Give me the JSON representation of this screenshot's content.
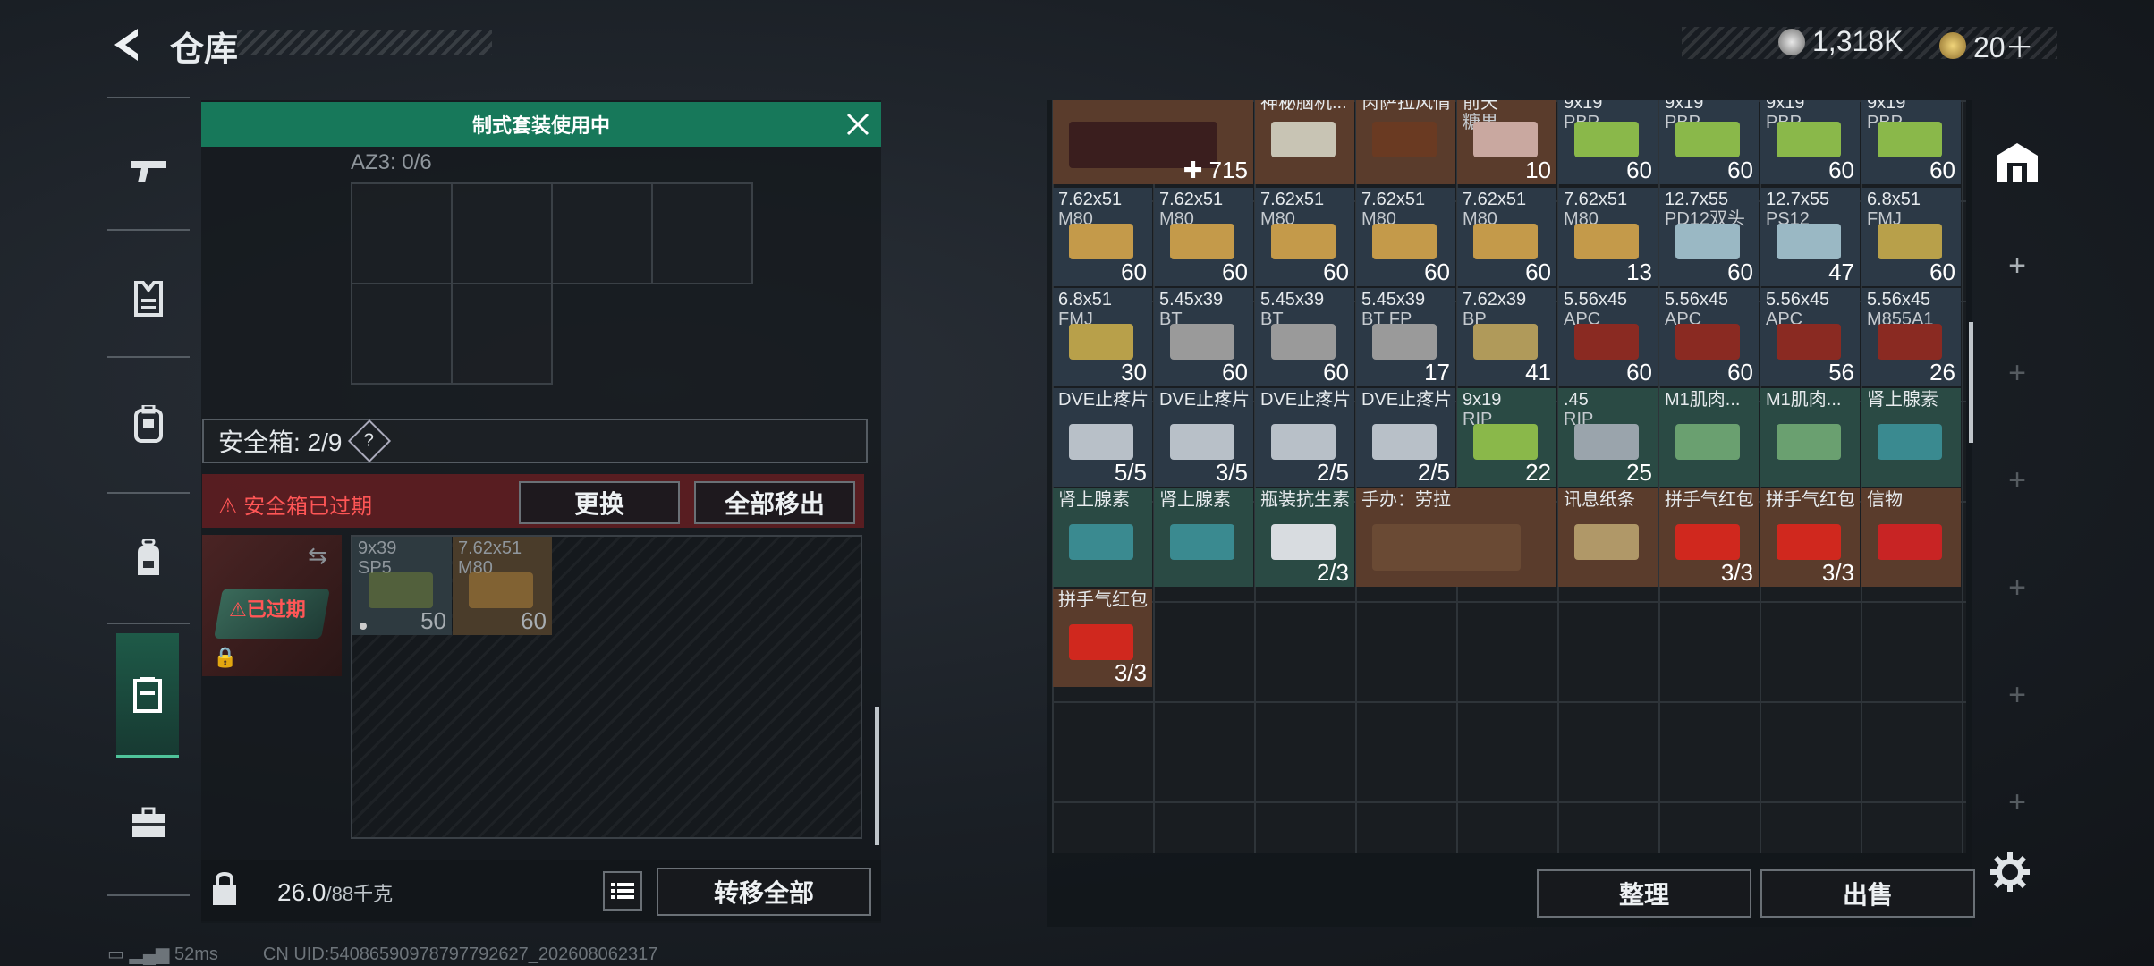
{
  "header": {
    "title": "仓库",
    "currency": [
      {
        "icon": "silver-coin-icon",
        "value": "1,318K"
      },
      {
        "icon": "gold-coin-icon",
        "value": "20＋"
      }
    ]
  },
  "left": {
    "kit_banner": "制式套装使用中",
    "az3_label": "AZ3: 0/6",
    "safe_box_label": "安全箱: 2/9",
    "safe_box_help": "?",
    "expired_warning": "安全箱已过期",
    "replace_label": "更换",
    "move_all_out_label": "全部移出",
    "thumb_expired": "已过期",
    "safe_items": [
      {
        "name": "9x39",
        "name2": "SP5",
        "count": "50",
        "color": "#7a8a3a"
      },
      {
        "name": "7.62x51",
        "name2": "M80",
        "count": "60",
        "color": "#a67c3a"
      }
    ],
    "weight_value": "26.0",
    "weight_max": "/88千克",
    "transfer_all_label": "转移全部"
  },
  "inventory": {
    "rows": [
      [
        {
          "name": "",
          "count": "715",
          "count_prefix": "✚",
          "color": "#3a1e1e",
          "span": 2,
          "bg": "#5a3c2c"
        },
        {
          "name": "神秘脑机...",
          "count": "",
          "color": "#c8c4b4",
          "bg": "#5a3c2c"
        },
        {
          "name": "芮萨拉风情",
          "count": "",
          "color": "#6a3a22",
          "bg": "#5a3c2c"
        },
        {
          "name": "前天",
          "name2": "糖果",
          "count": "10",
          "color": "#c9a8a0",
          "bg": "#5a3c2c"
        },
        {
          "name": "9x19",
          "name2": "PBP",
          "count": "60",
          "color": "#8ab84a",
          "bg": "#2c3946"
        },
        {
          "name": "9x19",
          "name2": "PBP",
          "count": "60",
          "color": "#8ab84a",
          "bg": "#2c3946"
        },
        {
          "name": "9x19",
          "name2": "PBP",
          "count": "60",
          "color": "#8ab84a",
          "bg": "#2c3946"
        },
        {
          "name": "9x19",
          "name2": "PBP",
          "count": "60",
          "color": "#8ab84a",
          "bg": "#2c3946"
        }
      ],
      [
        {
          "name": "7.62x51",
          "name2": "M80",
          "count": "60",
          "color": "#c49a4a",
          "bg": "#2c3946"
        },
        {
          "name": "7.62x51",
          "name2": "M80",
          "count": "60",
          "color": "#c49a4a",
          "bg": "#2c3946"
        },
        {
          "name": "7.62x51",
          "name2": "M80",
          "count": "60",
          "color": "#c49a4a",
          "bg": "#2c3946"
        },
        {
          "name": "7.62x51",
          "name2": "M80",
          "count": "60",
          "color": "#c49a4a",
          "bg": "#2c3946"
        },
        {
          "name": "7.62x51",
          "name2": "M80",
          "count": "60",
          "color": "#c49a4a",
          "bg": "#2c3946"
        },
        {
          "name": "7.62x51",
          "name2": "M80",
          "count": "13",
          "color": "#c49a4a",
          "bg": "#2c3946"
        },
        {
          "name": "12.7x55",
          "name2": "PD12双头",
          "count": "60",
          "color": "#9ab8c4",
          "bg": "#2c3946"
        },
        {
          "name": "12.7x55",
          "name2": "PS12",
          "count": "47",
          "color": "#9ab8c4",
          "bg": "#2c3946"
        },
        {
          "name": "6.8x51",
          "name2": "FMJ",
          "count": "60",
          "color": "#b8a04a",
          "bg": "#2c3946"
        }
      ],
      [
        {
          "name": "6.8x51",
          "name2": "FMJ",
          "count": "30",
          "color": "#b8a04a",
          "bg": "#2c3946"
        },
        {
          "name": "5.45x39",
          "name2": "BT",
          "count": "60",
          "color": "#9a9a9a",
          "bg": "#2c3946"
        },
        {
          "name": "5.45x39",
          "name2": "BT",
          "count": "60",
          "color": "#9a9a9a",
          "bg": "#2c3946"
        },
        {
          "name": "5.45x39",
          "name2": "BT FP",
          "count": "17",
          "color": "#9a9a9a",
          "bg": "#2c3946"
        },
        {
          "name": "7.62x39",
          "name2": "BP",
          "count": "41",
          "color": "#b09a5a",
          "bg": "#2c3946"
        },
        {
          "name": "5.56x45",
          "name2": "APC",
          "count": "60",
          "color": "#8a2a22",
          "bg": "#2c3946"
        },
        {
          "name": "5.56x45",
          "name2": "APC",
          "count": "60",
          "color": "#8a2a22",
          "bg": "#2c3946"
        },
        {
          "name": "5.56x45",
          "name2": "APC",
          "count": "56",
          "color": "#8a2a22",
          "bg": "#2c3946"
        },
        {
          "name": "5.56x45",
          "name2": "M855A1",
          "count": "26",
          "color": "#8a2a22",
          "bg": "#2c3946"
        }
      ],
      [
        {
          "name": "DVE止疼片",
          "count": "5/5",
          "color": "#b8c0c8",
          "bg": "#2c3946"
        },
        {
          "name": "DVE止疼片",
          "count": "3/5",
          "color": "#b8c0c8",
          "bg": "#2c3946"
        },
        {
          "name": "DVE止疼片",
          "count": "2/5",
          "color": "#b8c0c8",
          "bg": "#2c3946"
        },
        {
          "name": "DVE止疼片",
          "count": "2/5",
          "color": "#b8c0c8",
          "bg": "#2c3946"
        },
        {
          "name": "9x19",
          "name2": "RIP",
          "count": "22",
          "color": "#8ab84a",
          "bg": "#2a4a44"
        },
        {
          "name": ".45",
          "name2": "RIP",
          "count": "25",
          "color": "#9aa4ac",
          "bg": "#2a4a44"
        },
        {
          "name": "M1肌肉...",
          "count": "",
          "color": "#6aa070",
          "bg": "#2a4a44"
        },
        {
          "name": "M1肌肉...",
          "count": "",
          "color": "#6aa070",
          "bg": "#2a4a44"
        },
        {
          "name": "肾上腺素",
          "count": "",
          "color": "#3a8a90",
          "bg": "#2a4a44"
        }
      ],
      [
        {
          "name": "肾上腺素",
          "count": "",
          "color": "#3a8a90",
          "bg": "#2a4a44"
        },
        {
          "name": "肾上腺素",
          "count": "",
          "color": "#3a8a90",
          "bg": "#2a4a44"
        },
        {
          "name": "瓶装抗生素",
          "count": "2/3",
          "color": "#d8dce0",
          "bg": "#2a4a44"
        },
        {
          "name": "手办：劳拉",
          "count": "",
          "color": "#6a4a34",
          "bg": "#5a3c2c",
          "span": 2
        },
        {
          "name": "讯息纸条",
          "count": "",
          "color": "#b09868",
          "bg": "#5a3c2c"
        },
        {
          "name": "拼手气红包",
          "count": "3/3",
          "color": "#d0281e",
          "bg": "#5a3c2c"
        },
        {
          "name": "拼手气红包",
          "count": "3/3",
          "color": "#d0281e",
          "bg": "#5a3c2c"
        },
        {
          "name": "信物",
          "count": "",
          "color": "#c82424",
          "bg": "#5a3c2c"
        }
      ],
      [
        {
          "name": "拼手气红包",
          "count": "3/3",
          "color": "#d0281e",
          "bg": "#5a3c2c"
        }
      ]
    ],
    "sort_label": "整理",
    "sell_label": "出售"
  },
  "footer": {
    "ping": "52ms",
    "uid": "CN UID:540865909787977926​27_202608062317"
  }
}
